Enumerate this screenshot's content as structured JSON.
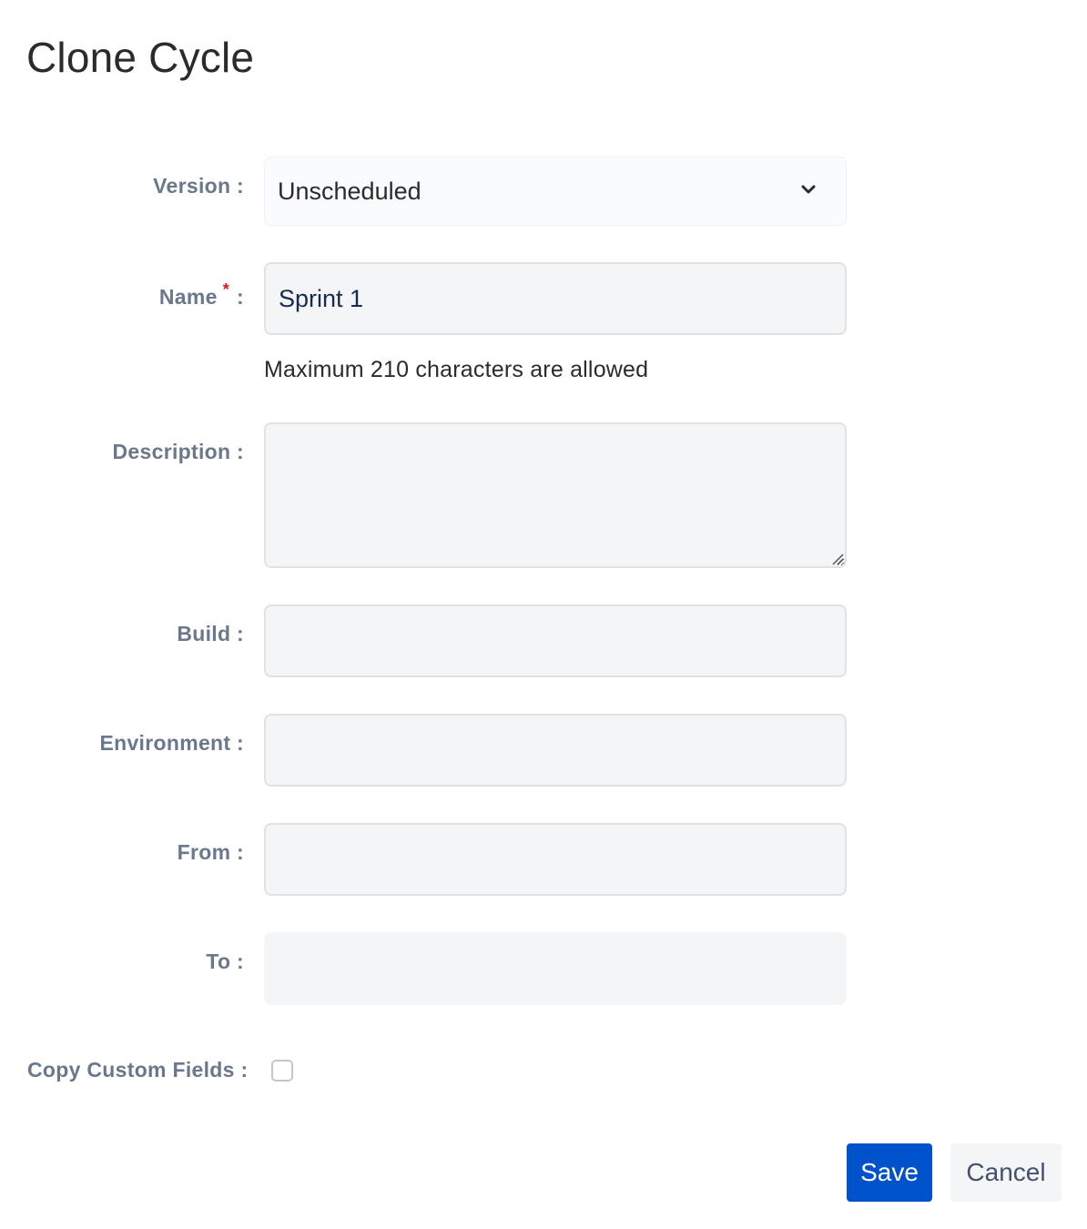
{
  "dialog": {
    "title": "Clone Cycle"
  },
  "form": {
    "version": {
      "label": "Version :",
      "selected": "Unscheduled",
      "icon": "chevron-down-icon"
    },
    "name": {
      "label": "Name",
      "required_marker": "*",
      "colon": ":",
      "value": "Sprint 1",
      "helper": "Maximum 210 characters are allowed"
    },
    "description": {
      "label": "Description :",
      "value": ""
    },
    "build": {
      "label": "Build :",
      "value": ""
    },
    "environment": {
      "label": "Environment :",
      "value": ""
    },
    "from": {
      "label": "From :",
      "value": ""
    },
    "to": {
      "label": "To :",
      "value": ""
    },
    "copy_custom_fields": {
      "label": "Copy Custom Fields :",
      "checked": false
    }
  },
  "actions": {
    "save_label": "Save",
    "cancel_label": "Cancel"
  },
  "colors": {
    "primary": "#0052cc",
    "label": "#6b778c",
    "required": "#e5141c",
    "field_bg": "#f4f5f7",
    "field_border": "#dfe1e6"
  }
}
